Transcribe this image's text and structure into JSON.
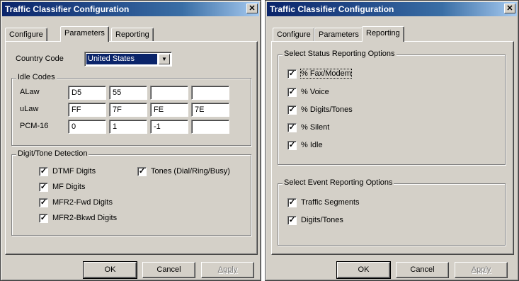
{
  "dialog_left": {
    "title": "Traffic Classifier Configuration",
    "close_glyph": "✕",
    "tabs": [
      "Configure",
      "Parameters",
      "Reporting"
    ],
    "country_code_label": "Country Code",
    "country_code_value": "United States",
    "idle_codes": {
      "legend": "Idle Codes",
      "rows": [
        {
          "label": "ALaw",
          "values": [
            "D5",
            "55",
            "",
            ""
          ]
        },
        {
          "label": "uLaw",
          "values": [
            "FF",
            "7F",
            "FE",
            "7E"
          ]
        },
        {
          "label": "PCM-16",
          "values": [
            "0",
            "1",
            "-1",
            ""
          ]
        }
      ]
    },
    "digit_tone": {
      "legend": "Digit/Tone Detection",
      "dtmf": "DTMF Digits",
      "tones": "Tones (Dial/Ring/Busy)",
      "mf": "MF Digits",
      "mfr2_fwd": "MFR2-Fwd Digits",
      "mfr2_bkwd": "MFR2-Bkwd  Digits",
      "check_glyph": "✓"
    },
    "buttons": {
      "ok": "OK",
      "cancel": "Cancel",
      "apply": "Apply"
    }
  },
  "dialog_right": {
    "title": "Traffic Classifier Configuration",
    "close_glyph": "✕",
    "tabs": [
      "Configure",
      "Parameters",
      "Reporting"
    ],
    "status_group": {
      "legend": "Select Status Reporting Options",
      "items": [
        "% Fax/Modem",
        "% Voice",
        "% Digits/Tones",
        "% Silent",
        "% Idle"
      ]
    },
    "event_group": {
      "legend": "Select Event Reporting Options",
      "items": [
        "Traffic Segments",
        "Digits/Tones"
      ]
    },
    "check_glyph": "✓",
    "buttons": {
      "ok": "OK",
      "cancel": "Cancel",
      "apply": "Apply"
    }
  }
}
